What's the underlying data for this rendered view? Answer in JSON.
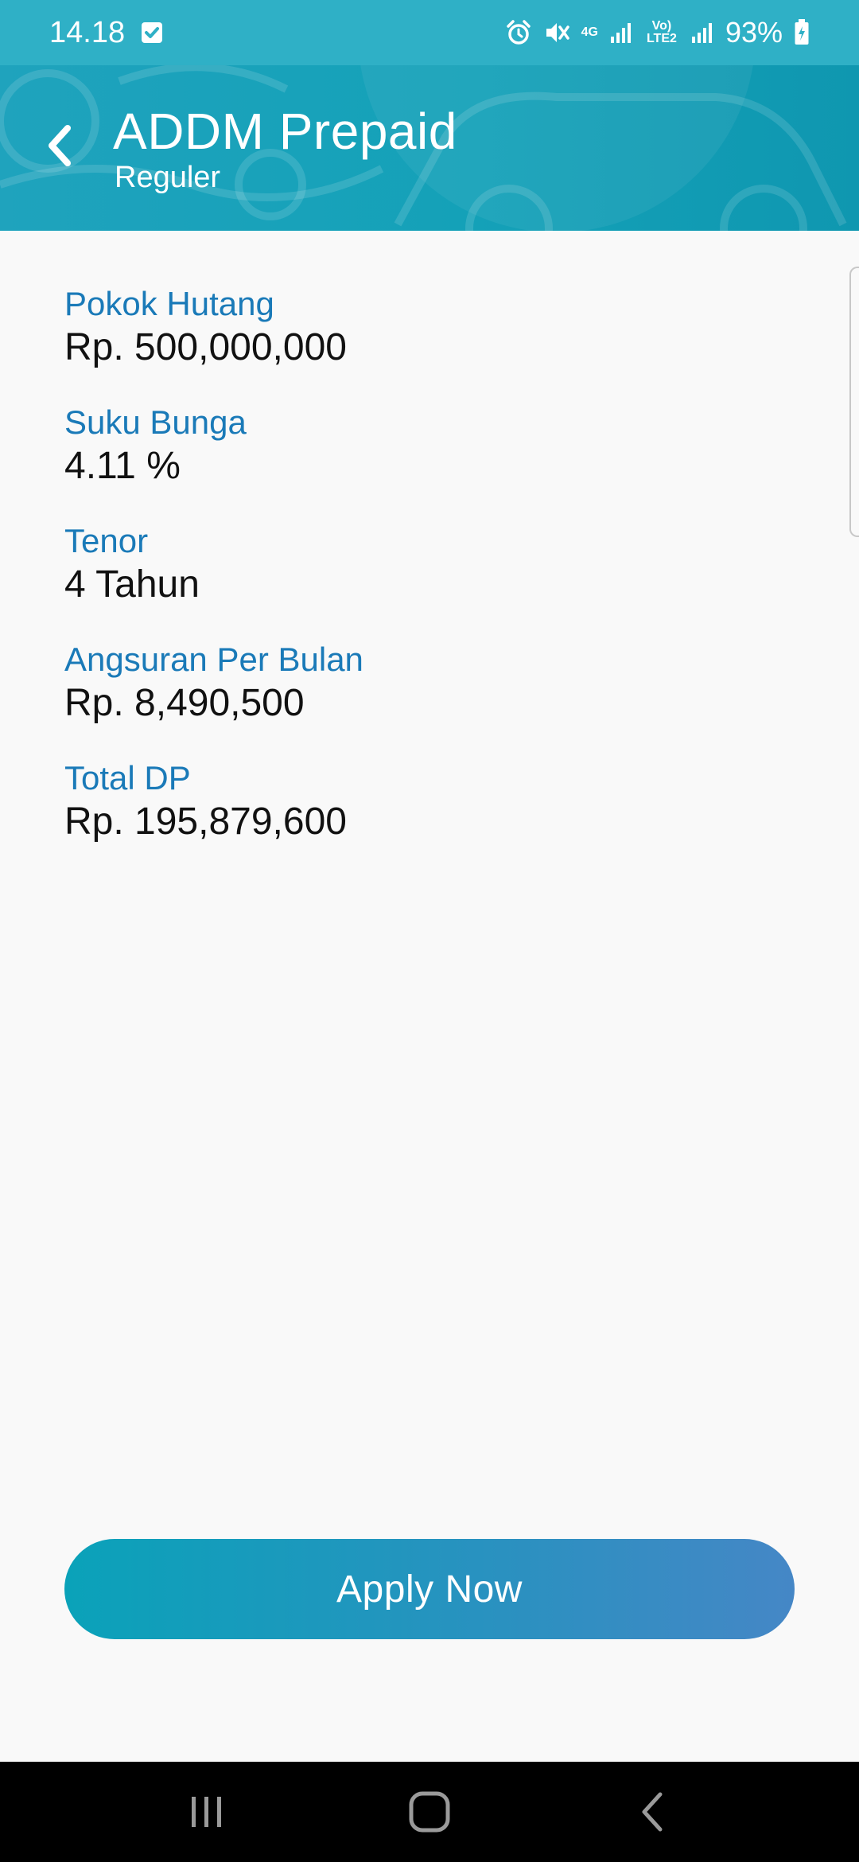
{
  "status_bar": {
    "time": "14.18",
    "battery": "93%",
    "net_label": "4G",
    "volte_label": "Vo) LTE2"
  },
  "header": {
    "title": "ADDM Prepaid",
    "subtitle": "Reguler"
  },
  "fields": [
    {
      "label": "Pokok Hutang",
      "value": "Rp. 500,000,000"
    },
    {
      "label": "Suku Bunga",
      "value": "4.11 %"
    },
    {
      "label": "Tenor",
      "value": "4 Tahun"
    },
    {
      "label": "Angsuran Per Bulan",
      "value": "Rp. 8,490,500"
    },
    {
      "label": "Total DP",
      "value": "Rp. 195,879,600"
    }
  ],
  "apply_button": {
    "label": "Apply Now"
  },
  "colors": {
    "status_bar": "#2fb0c6",
    "header": "#14a1b8",
    "label": "#1a7ab8",
    "button_start": "#0aa2b9",
    "button_end": "#4587c6"
  },
  "icons": {
    "check": "check-square-icon",
    "alarm": "alarm-icon",
    "mute": "mute-icon",
    "signal1": "signal-icon",
    "signal2": "signal-icon",
    "battery": "battery-charging-icon",
    "back": "chevron-left-icon",
    "nav_recents": "recents-icon",
    "nav_home": "home-icon",
    "nav_back": "back-icon"
  }
}
